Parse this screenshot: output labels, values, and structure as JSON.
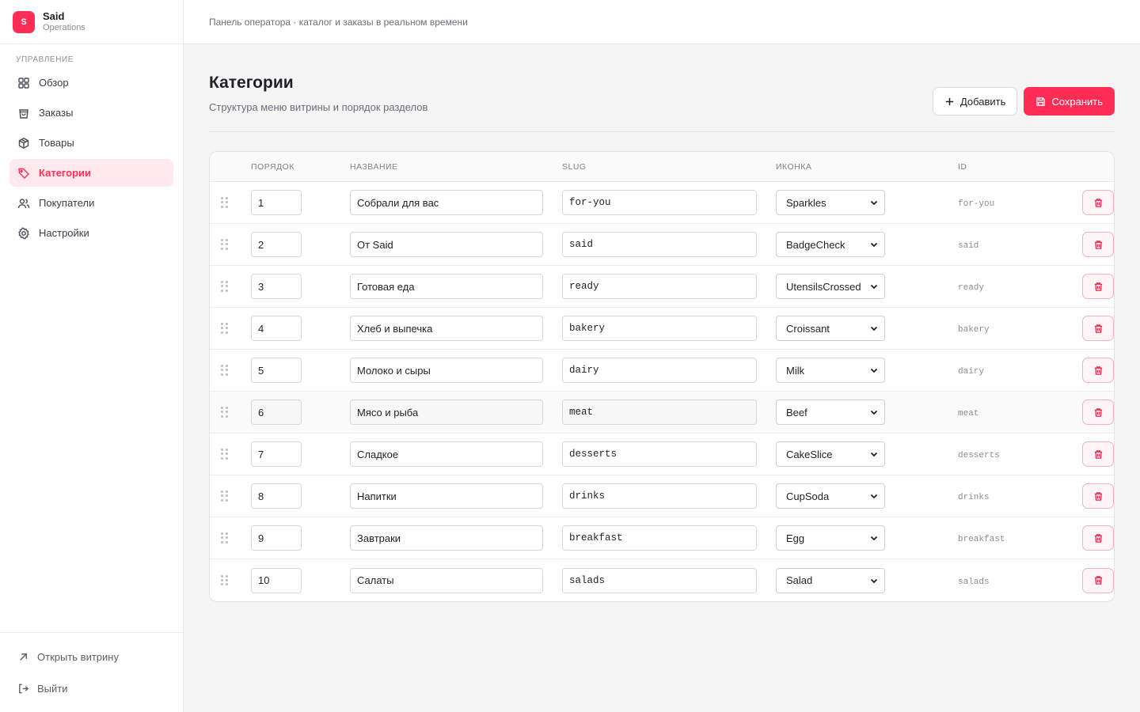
{
  "brand": {
    "logo_letter": "S",
    "name": "Said",
    "subtitle": "Operations"
  },
  "sidebar": {
    "section_label": "УПРАВЛЕНИЕ",
    "items": [
      {
        "label": "Обзор",
        "icon": "grid-icon",
        "active": false
      },
      {
        "label": "Заказы",
        "icon": "shopping-bag-icon",
        "active": false
      },
      {
        "label": "Товары",
        "icon": "package-icon",
        "active": false
      },
      {
        "label": "Категории",
        "icon": "tag-icon",
        "active": true
      },
      {
        "label": "Покупатели",
        "icon": "users-icon",
        "active": false
      },
      {
        "label": "Настройки",
        "icon": "settings-icon",
        "active": false
      }
    ],
    "footer": {
      "open_store": "Открыть витрину",
      "logout": "Выйти"
    }
  },
  "topbar": {
    "text": "Панель оператора · каталог и заказы в реальном времени"
  },
  "page": {
    "title": "Категории",
    "subtitle": "Структура меню витрины и порядок разделов",
    "add_label": "Добавить",
    "save_label": "Сохранить"
  },
  "table": {
    "headers": {
      "order": "ПОРЯДОК",
      "name": "НАЗВАНИЕ",
      "slug": "SLUG",
      "icon": "ИКОНКА",
      "id": "ID"
    },
    "rows": [
      {
        "order": "1",
        "name": "Собрали для вас",
        "slug": "for-you",
        "icon": "Sparkles",
        "id": "for-you"
      },
      {
        "order": "2",
        "name": "От Said",
        "slug": "said",
        "icon": "BadgeCheck",
        "id": "said"
      },
      {
        "order": "3",
        "name": "Готовая еда",
        "slug": "ready",
        "icon": "UtensilsCrossed",
        "id": "ready"
      },
      {
        "order": "4",
        "name": "Хлеб и выпечка",
        "slug": "bakery",
        "icon": "Croissant",
        "id": "bakery"
      },
      {
        "order": "5",
        "name": "Молоко и сыры",
        "slug": "dairy",
        "icon": "Milk",
        "id": "dairy"
      },
      {
        "order": "6",
        "name": "Мясо и рыба",
        "slug": "meat",
        "icon": "Beef",
        "id": "meat"
      },
      {
        "order": "7",
        "name": "Сладкое",
        "slug": "desserts",
        "icon": "CakeSlice",
        "id": "desserts"
      },
      {
        "order": "8",
        "name": "Напитки",
        "slug": "drinks",
        "icon": "CupSoda",
        "id": "drinks"
      },
      {
        "order": "9",
        "name": "Завтраки",
        "slug": "breakfast",
        "icon": "Egg",
        "id": "breakfast"
      },
      {
        "order": "10",
        "name": "Салаты",
        "slug": "salads",
        "icon": "Salad",
        "id": "salads"
      }
    ]
  },
  "colors": {
    "accent": "#ff2d55",
    "accent_soft": "#ffe9ee",
    "danger_border": "#f2b3c0"
  }
}
